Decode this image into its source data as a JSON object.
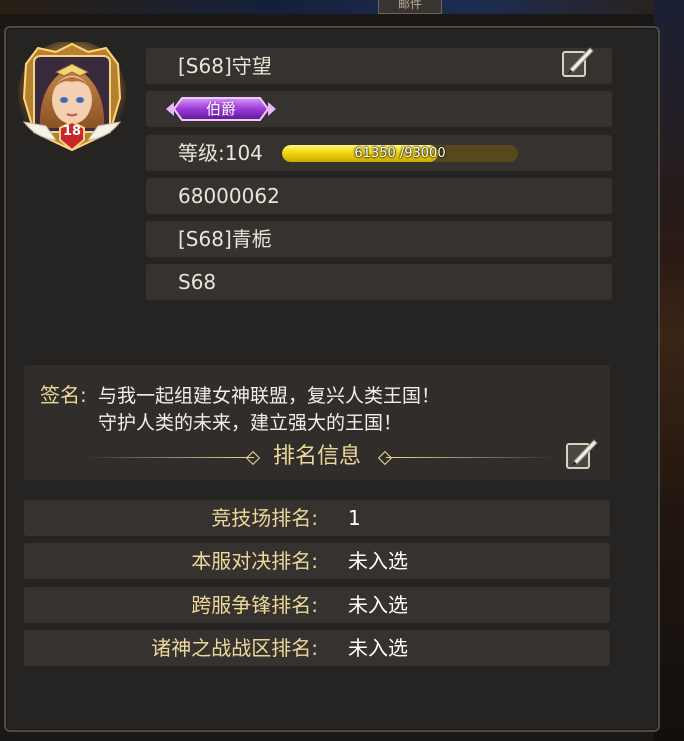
{
  "top_tab_fragment": "邮件",
  "profile": {
    "avatar_level": "18",
    "name": "[S68]守望",
    "title_badge": "伯爵",
    "level_label": "等级:104",
    "exp_text": "61350 /93000",
    "exp_fraction": 0.6597,
    "player_id": "68000062",
    "guild": "[S68]青栀",
    "server": "S68"
  },
  "signature": {
    "label": "签名:",
    "lines": [
      "与我一起组建女神联盟，复兴人类王国！",
      "守护人类的未来，建立强大的王国！"
    ]
  },
  "ranking": {
    "header": "排名信息",
    "rows": [
      {
        "label": "竞技场排名:",
        "value": "1"
      },
      {
        "label": "本服对决排名:",
        "value": "未入选"
      },
      {
        "label": "跨服争锋排名:",
        "value": "未入选"
      },
      {
        "label": "诸神之战战区排名:",
        "value": "未入选"
      }
    ]
  },
  "colors": {
    "panel_bg": "#262422",
    "row_bg": "#353230",
    "gold_text": "#ecd89a",
    "badge_purple": "#9b3ad8",
    "exp_fill": "#f2d20a"
  },
  "icons": {
    "edit": "pencil-note-icon",
    "avatar": "character-portrait",
    "level_badge": "heart-shield-icon"
  }
}
